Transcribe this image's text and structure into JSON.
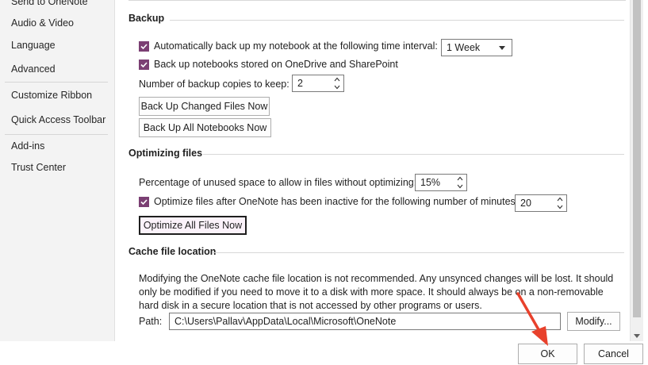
{
  "sidebar": {
    "items": [
      {
        "label": "Send to OneNote"
      },
      {
        "label": "Audio & Video"
      },
      {
        "label": "Language"
      },
      {
        "label": "Advanced"
      },
      {
        "label": "Customize Ribbon"
      },
      {
        "label": "Quick Access Toolbar"
      },
      {
        "label": "Add-ins"
      },
      {
        "label": "Trust Center"
      }
    ]
  },
  "backup": {
    "title": "Backup",
    "auto_backup_label": "Automatically back up my notebook at the following time interval:",
    "auto_backup_checked": true,
    "interval_value": "1 Week",
    "onedrive_label": "Back up notebooks stored on OneDrive and SharePoint",
    "onedrive_checked": true,
    "copies_label": "Number of backup copies to keep:",
    "copies_value": "2",
    "backup_changed_label": "Back Up Changed Files Now",
    "backup_all_label": "Back Up All Notebooks Now"
  },
  "optimizing": {
    "title": "Optimizing files",
    "unused_space_label": "Percentage of unused space to allow in files without optimizing:",
    "unused_space_value": "15%",
    "optimize_after_label": "Optimize files after OneNote has been inactive for the following number of minutes:",
    "optimize_after_checked": true,
    "minutes_value": "20",
    "optimize_all_label": "Optimize All Files Now"
  },
  "cache": {
    "title": "Cache file location",
    "description": "Modifying the OneNote cache file location is not recommended. Any unsynced changes will be lost. It should only be modified if you need to move it to a disk with more space. It should always be on a non-removable hard disk in a secure location that is not accessed by other programs or users.",
    "path_label": "Path:",
    "path_value": "C:\\Users\\Pallav\\AppData\\Local\\Microsoft\\OneNote",
    "modify_label": "Modify..."
  },
  "footer": {
    "ok_label": "OK",
    "cancel_label": "Cancel"
  },
  "colors": {
    "checkbox_accent": "#7b3f73",
    "annotation_arrow": "#e8412c"
  }
}
